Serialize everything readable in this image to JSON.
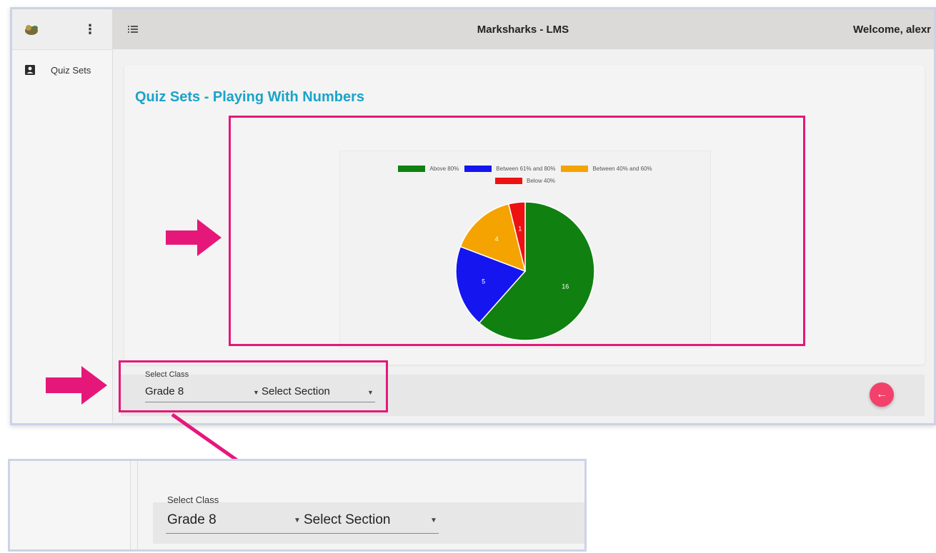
{
  "app": {
    "title": "Marksharks - LMS",
    "welcome": "Welcome, alexr"
  },
  "sidebar": {
    "items": [
      {
        "label": "Quiz Sets",
        "icon": "account-box-icon"
      }
    ]
  },
  "page": {
    "title": "Quiz Sets - Playing With Numbers"
  },
  "filters": {
    "class_label": "Select Class",
    "class_value": "Grade 8",
    "section_value": "Select Section"
  },
  "zoom_inset": {
    "class_label": "Select Class",
    "class_value": "Grade 8",
    "section_value": "Select Section"
  },
  "colors": {
    "accent_title": "#1aa3c9",
    "highlight": "#e5187a",
    "fab": "#f2416b"
  },
  "chart_data": {
    "type": "pie",
    "title": "",
    "categories": [
      "Above 80%",
      "Between 61% and 80%",
      "Between 40% and 60%",
      "Below 40%"
    ],
    "values": [
      16,
      5,
      4,
      1
    ],
    "colors": [
      "#108010",
      "#1515f0",
      "#f5a300",
      "#ee1111"
    ],
    "legend": "top"
  }
}
